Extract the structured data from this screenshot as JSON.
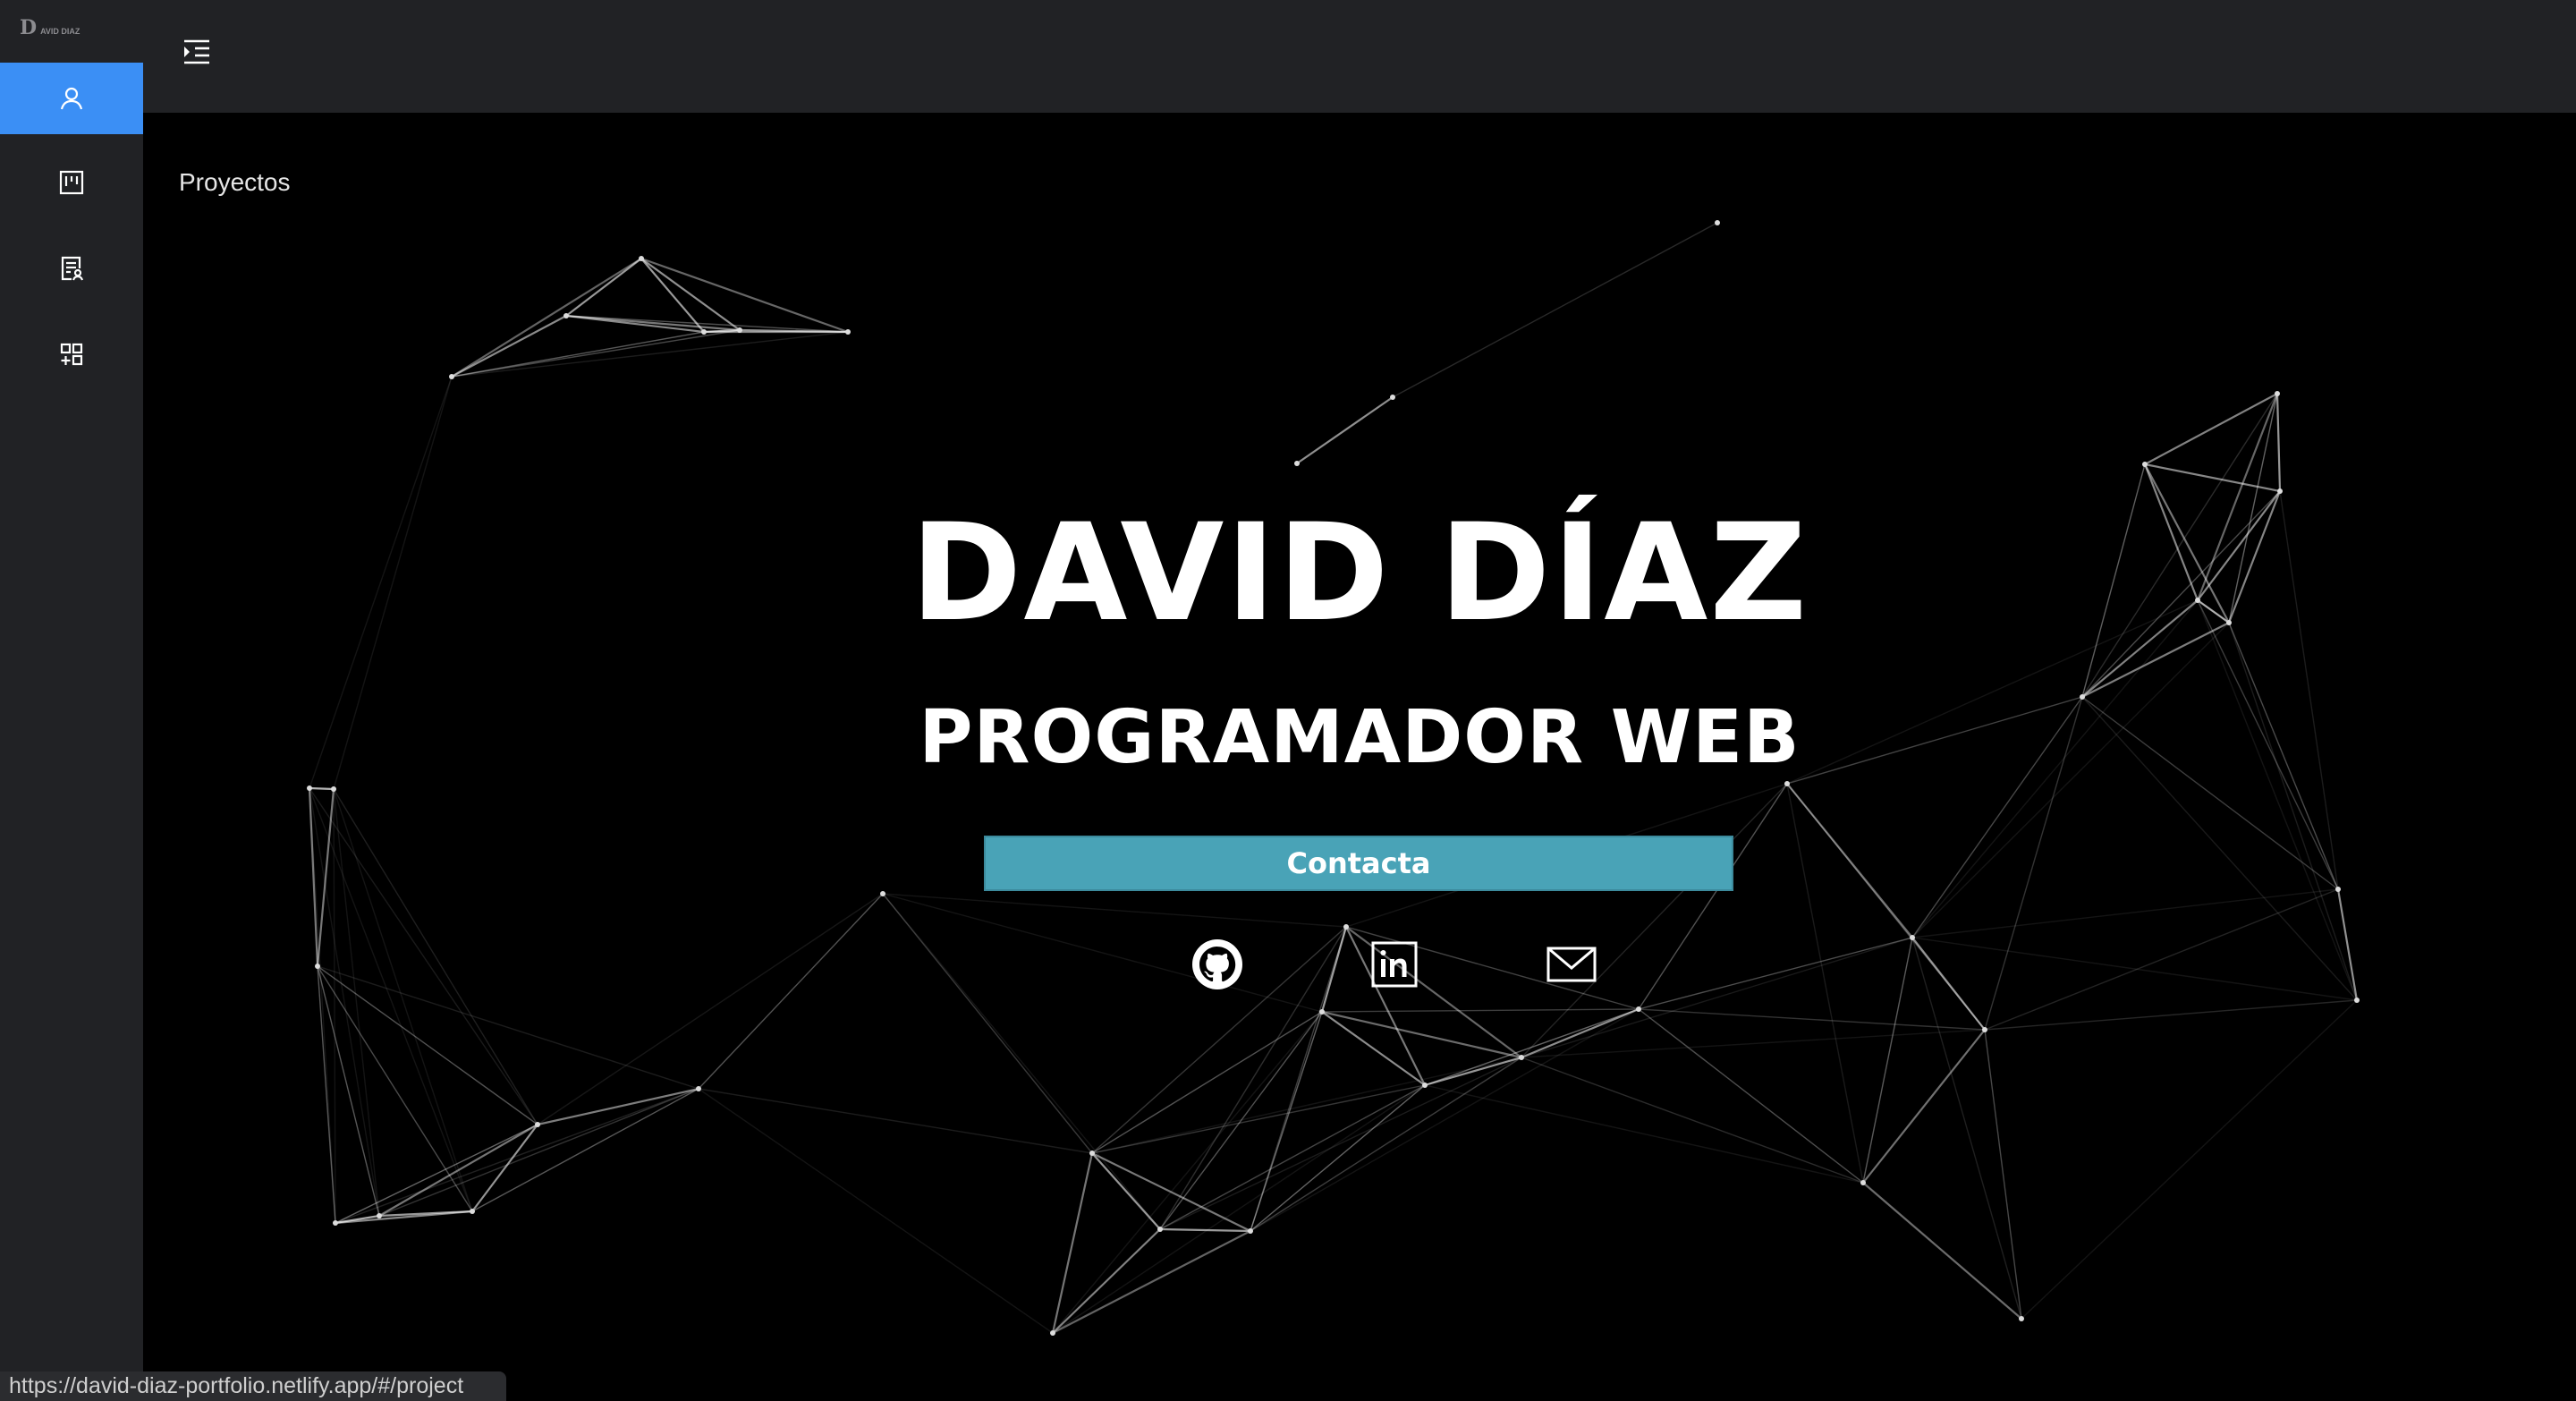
{
  "app": {
    "logo_mark": "D",
    "logo_text": "AVID DIAZ"
  },
  "sidebar": {
    "items": [
      {
        "name": "about",
        "icon": "user-icon",
        "active": true
      },
      {
        "name": "projects",
        "icon": "kanban-board-icon",
        "active": false
      },
      {
        "name": "resume",
        "icon": "document-user-icon",
        "active": false
      },
      {
        "name": "skills",
        "icon": "grid-add-icon",
        "active": false
      }
    ],
    "accent": "#3b8ff5"
  },
  "topbar": {
    "menu_icon": "menu-unfold-icon"
  },
  "main": {
    "breadcrumb": "Proyectos",
    "hero": {
      "name": "DAVID DÍAZ",
      "role": "PROGRAMADOR WEB",
      "cta_label": "Contacta",
      "cta_color": "#49a3b7"
    },
    "social": [
      {
        "name": "github",
        "icon": "github-icon"
      },
      {
        "name": "linkedin",
        "icon": "linkedin-icon"
      },
      {
        "name": "email",
        "icon": "mail-icon"
      }
    ]
  },
  "statusbar": {
    "url": "https://david-diaz-portfolio.netlify.app/#/project"
  }
}
